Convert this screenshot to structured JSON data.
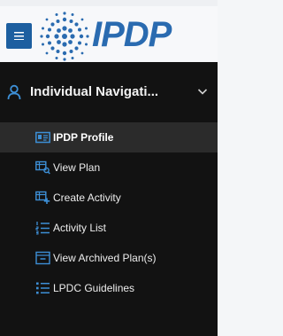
{
  "header": {
    "brand": "IPDP",
    "menu_icon": "hamburger-icon",
    "logo_icon": "dotted-globe-logo",
    "accent": "#1d5fa0",
    "brand_color": "#2a6bb0"
  },
  "sidebar": {
    "group": {
      "label": "Individual Navigati...",
      "icon": "user-icon",
      "chevron_icon": "chevron-down-icon"
    },
    "items": [
      {
        "label": "IPDP Profile",
        "icon": "id-card-icon",
        "active": true
      },
      {
        "label": "View Plan",
        "icon": "plan-view-icon",
        "active": false
      },
      {
        "label": "Create Activity",
        "icon": "plan-add-icon",
        "active": false
      },
      {
        "label": "Activity List",
        "icon": "numbered-list-icon",
        "active": false
      },
      {
        "label": "View Archived Plan(s)",
        "icon": "archive-window-icon",
        "active": false
      },
      {
        "label": "LPDC Guidelines",
        "icon": "bullet-list-icon",
        "active": false
      }
    ],
    "background": "#121212",
    "active_background": "#2b2b2b",
    "icon_color": "#3d8fd6"
  }
}
